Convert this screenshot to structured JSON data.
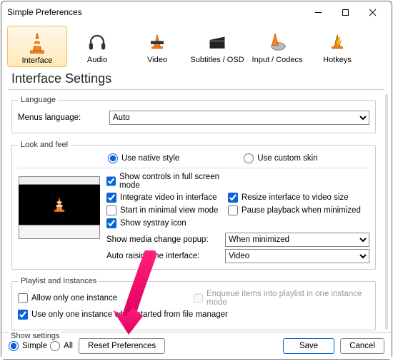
{
  "window": {
    "title": "Simple Preferences"
  },
  "tabs": {
    "interface": "Interface",
    "audio": "Audio",
    "video": "Video",
    "subtitles": "Subtitles / OSD",
    "codecs": "Input / Codecs",
    "hotkeys": "Hotkeys"
  },
  "heading": "Interface Settings",
  "language": {
    "legend": "Language",
    "menus_label": "Menus language:",
    "value": "Auto"
  },
  "lookfeel": {
    "legend": "Look and feel",
    "native": "Use native style",
    "custom": "Use custom skin",
    "show_controls_fs": "Show controls in full screen mode",
    "integrate_video": "Integrate video in interface",
    "resize_to_video": "Resize interface to video size",
    "start_minimal": "Start in minimal view mode",
    "pause_minimized": "Pause playback when minimized",
    "systray": "Show systray icon",
    "media_change_label": "Show media change popup:",
    "media_change_value": "When minimized",
    "auto_raise_label": "Auto raising the interface:",
    "auto_raise_value": "Video"
  },
  "playlist": {
    "legend": "Playlist and Instances",
    "allow_one": "Allow only one instance",
    "enqueue": "Enqueue items into playlist in one instance mode",
    "one_from_fm": "Use only one instance when started from file manager"
  },
  "footer": {
    "show_settings": "Show settings",
    "simple": "Simple",
    "all": "All",
    "reset": "Reset Preferences",
    "save": "Save",
    "cancel": "Cancel"
  }
}
